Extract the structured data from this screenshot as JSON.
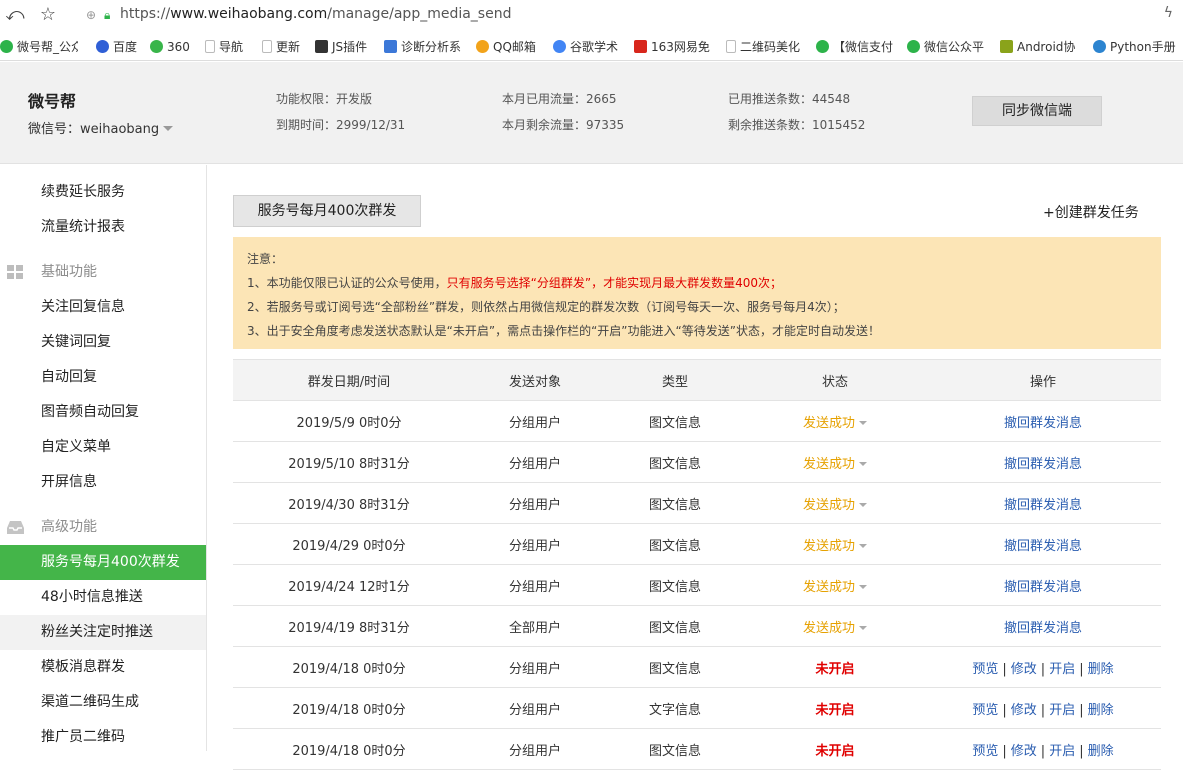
{
  "browser": {
    "url_scheme": "https://",
    "url_host": "www.weihaobang.com",
    "url_path": "/manage/app_media_send",
    "bookmarks": [
      {
        "label": "微号帮_公众",
        "icon": "wechat-icon",
        "color": "#2db34a"
      },
      {
        "label": "百度",
        "icon": "baidu-paw-icon",
        "color": "#2f5fd6"
      },
      {
        "label": "360",
        "icon": "360-icon",
        "color": "#39b54a"
      },
      {
        "label": "导航",
        "icon": "page-icon",
        "color": "#bbbbbb"
      },
      {
        "label": "更新",
        "icon": "page-icon",
        "color": "#bbbbbb"
      },
      {
        "label": "JS插件",
        "icon": "js-icon",
        "color": "#333333"
      },
      {
        "label": "诊断分析系",
        "icon": "diagnose-icon",
        "color": "#3c78d8"
      },
      {
        "label": "QQ邮箱",
        "icon": "qq-mail-icon",
        "color": "#f2a31b"
      },
      {
        "label": "谷歌学术",
        "icon": "google-icon",
        "color": "#4285f4"
      },
      {
        "label": "163网易免",
        "icon": "netease-icon",
        "color": "#d8261c"
      },
      {
        "label": "二维码美化",
        "icon": "page-icon",
        "color": "#bbbbbb"
      },
      {
        "label": "【微信支付",
        "icon": "wechat-icon",
        "color": "#2db34a"
      },
      {
        "label": "微信公众平",
        "icon": "wechat-icon",
        "color": "#2db34a"
      },
      {
        "label": "Android协",
        "icon": "android-icon",
        "color": "#8aa31b"
      },
      {
        "label": "Python手册",
        "icon": "python-icon",
        "color": "#2c84d0"
      }
    ]
  },
  "header": {
    "brand": "微号帮",
    "wechat_id": "微信号：weihaobang",
    "permission": "功能权限：开发版",
    "expire": "到期时间：2999/12/31",
    "used_traffic": "本月已用流量：2665",
    "remain_traffic": "本月剩余流量：97335",
    "used_push": "已用推送条数：44548",
    "remain_push": "剩余推送条数：1015452",
    "sync_button": "同步微信端"
  },
  "sidebar": {
    "items_top": [
      "续费延长服务",
      "流量统计报表"
    ],
    "group_basic": "基础功能",
    "items_basic": [
      "关注回复信息",
      "关键词回复",
      "自动回复",
      "图音频自动回复",
      "自定义菜单",
      "开屏信息"
    ],
    "group_advanced": "高级功能",
    "items_advanced": [
      "服务号每月400次群发",
      "48小时信息推送",
      "粉丝关注定时推送",
      "模板消息群发",
      "渠道二维码生成",
      "推广员二维码"
    ]
  },
  "main": {
    "tab_label": "服务号每月400次群发",
    "create_link": "+创建群发任务",
    "notice": {
      "title": "注意：",
      "line1_prefix": "1、本功能仅限已认证的公众号使用，",
      "line1_highlight": "只有服务号选择“分组群发”，才能实现月最大群发数量400次；",
      "line2": "2、若服务号或订阅号选“全部粉丝”群发，则依然占用微信规定的群发次数（订阅号每天一次、服务号每月4次）；",
      "line3": "3、出于安全角度考虑发送状态默认是“未开启”，需点击操作栏的“开启”功能进入“等待发送”状态，才能定时自动发送！"
    },
    "table": {
      "headers": [
        "群发日期/时间",
        "发送对象",
        "类型",
        "状态",
        "操作"
      ],
      "rows": [
        {
          "datetime": "2019/5/9  0时0分",
          "target": "分组用户",
          "type": "图文信息",
          "status": "发送成功",
          "status_kind": "ok",
          "action": "撤回群发消息"
        },
        {
          "datetime": "2019/5/10  8时31分",
          "target": "分组用户",
          "type": "图文信息",
          "status": "发送成功",
          "status_kind": "ok",
          "action": "撤回群发消息"
        },
        {
          "datetime": "2019/4/30  8时31分",
          "target": "分组用户",
          "type": "图文信息",
          "status": "发送成功",
          "status_kind": "ok",
          "action": "撤回群发消息"
        },
        {
          "datetime": "2019/4/29  0时0分",
          "target": "分组用户",
          "type": "图文信息",
          "status": "发送成功",
          "status_kind": "ok",
          "action": "撤回群发消息"
        },
        {
          "datetime": "2019/4/24  12时1分",
          "target": "分组用户",
          "type": "图文信息",
          "status": "发送成功",
          "status_kind": "ok",
          "action": "撤回群发消息"
        },
        {
          "datetime": "2019/4/19  8时31分",
          "target": "全部用户",
          "type": "图文信息",
          "status": "发送成功",
          "status_kind": "ok",
          "action": "撤回群发消息"
        },
        {
          "datetime": "2019/4/18  0时0分",
          "target": "分组用户",
          "type": "图文信息",
          "status": "未开启",
          "status_kind": "off",
          "actions": [
            "预览",
            "修改",
            "开启",
            "删除"
          ]
        },
        {
          "datetime": "2019/4/18  0时0分",
          "target": "分组用户",
          "type": "文字信息",
          "status": "未开启",
          "status_kind": "off",
          "actions": [
            "预览",
            "修改",
            "开启",
            "删除"
          ]
        },
        {
          "datetime": "2019/4/18  0时0分",
          "target": "分组用户",
          "type": "图文信息",
          "status": "未开启",
          "status_kind": "off",
          "actions": [
            "预览",
            "修改",
            "开启",
            "删除"
          ]
        }
      ]
    }
  },
  "colors": {
    "active_green": "#44b549",
    "notice_bg": "#fce5b6",
    "success_orange": "#e6a100",
    "off_red": "#e00000",
    "link_blue": "#2a5db0"
  }
}
